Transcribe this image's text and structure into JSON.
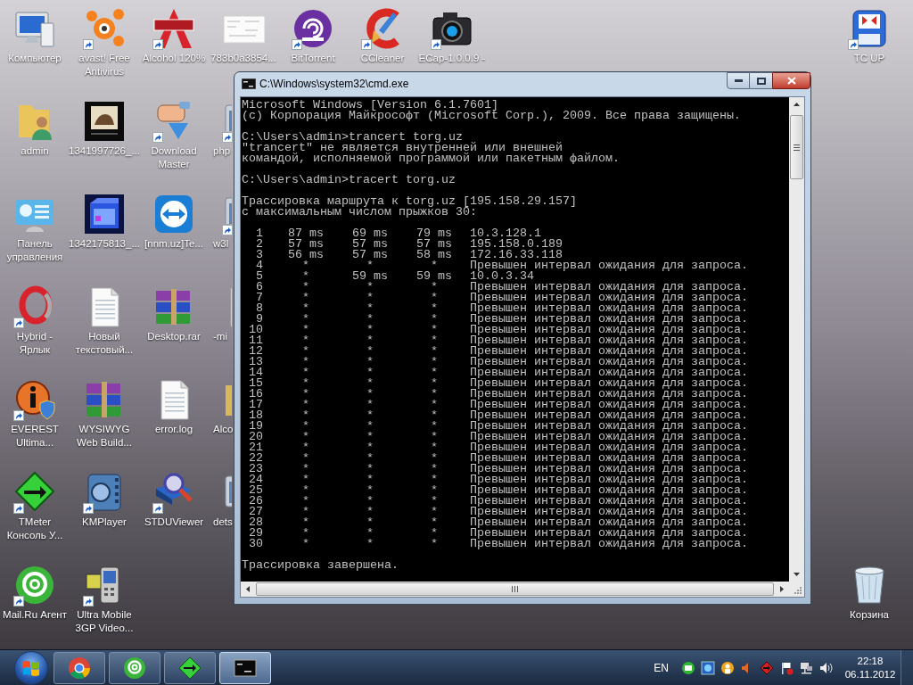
{
  "desktop": {
    "columns": [
      [
        {
          "label": "Компьютер",
          "shortcut": false,
          "covered": false
        },
        {
          "label": "admin",
          "shortcut": false,
          "covered": false
        },
        {
          "label": "Панель\nуправления",
          "shortcut": false,
          "covered": false
        },
        {
          "label": "Hybrid -\nЯрлык",
          "shortcut": true,
          "covered": false
        },
        {
          "label": "EVEREST\nUltima...",
          "shortcut": true,
          "covered": false
        },
        {
          "label": "TMeter\nКонсоль У...",
          "shortcut": true,
          "covered": false
        },
        {
          "label": "Mail.Ru Агент",
          "shortcut": true,
          "covered": false
        }
      ],
      [
        {
          "label": "avast! Free\nAntivirus",
          "shortcut": true,
          "covered": false
        },
        {
          "label": "1341997726_...",
          "shortcut": false,
          "covered": false
        },
        {
          "label": "1342175813_...",
          "shortcut": false,
          "covered": false
        },
        {
          "label": "Новый\nтекстовый...",
          "shortcut": false,
          "covered": false
        },
        {
          "label": "WYSIWYG\nWeb Build...",
          "shortcut": false,
          "covered": false
        },
        {
          "label": "KMPlayer",
          "shortcut": true,
          "covered": false
        },
        {
          "label": "Ultra Mobile\n3GP Video...",
          "shortcut": true,
          "covered": false
        }
      ],
      [
        {
          "label": "Alcohol 120%",
          "shortcut": true,
          "covered": false
        },
        {
          "label": "Download\nMaster",
          "shortcut": true,
          "covered": false
        },
        {
          "label": "[nnm.uz]Te...",
          "shortcut": false,
          "covered": false
        },
        {
          "label": "Desktop.rar",
          "shortcut": false,
          "covered": false
        },
        {
          "label": "error.log",
          "shortcut": false,
          "covered": false
        },
        {
          "label": "STDUViewer",
          "shortcut": true,
          "covered": false
        }
      ],
      [
        {
          "label": "783b0a3854...",
          "shortcut": false,
          "covered": false
        },
        {
          "label": "php",
          "shortcut": true,
          "covered": true
        },
        {
          "label": "w3l",
          "shortcut": true,
          "covered": true
        },
        {
          "label": "-mi",
          "shortcut": false,
          "covered": true
        },
        {
          "label": "Alco",
          "shortcut": false,
          "covered": true
        },
        {
          "label": "dets",
          "shortcut": false,
          "covered": true
        }
      ],
      [
        {
          "label": "BitTorrent",
          "shortcut": true,
          "covered": false
        }
      ],
      [
        {
          "label": "CCleaner",
          "shortcut": true,
          "covered": false
        }
      ],
      [
        {
          "label": "ECap-1.0.0.9 -",
          "shortcut": true,
          "covered": false
        }
      ]
    ],
    "right_column": [
      {
        "label": "TC UP",
        "shortcut": true,
        "covered": false
      },
      {
        "label": "Корзина",
        "shortcut": false,
        "covered": false
      }
    ]
  },
  "window": {
    "title": "C:\\Windows\\system32\\cmd.exe",
    "console": {
      "blocks": [
        [
          "Microsoft Windows [Version 6.1.7601]",
          "(c) Корпорация Майкрософт (Microsoft Corp.), 2009. Все права защищены."
        ],
        [
          "C:\\Users\\admin>trancert torg.uz",
          "\"trancert\" не является внутренней или внешней",
          "командой, исполняемой программой или пакетным файлом."
        ],
        [
          "C:\\Users\\admin>tracert torg.uz"
        ],
        [
          "Трассировка маршрута к torg.uz [195.158.29.157]",
          "с максимальным числом прыжков 30:"
        ]
      ],
      "hops": [
        {
          "hop": "1",
          "times": [
            "87 ms",
            "69 ms",
            "79 ms"
          ],
          "result": "10.3.128.1"
        },
        {
          "hop": "2",
          "times": [
            "57 ms",
            "57 ms",
            "57 ms"
          ],
          "result": "195.158.0.189"
        },
        {
          "hop": "3",
          "times": [
            "56 ms",
            "57 ms",
            "58 ms"
          ],
          "result": "172.16.33.118"
        },
        {
          "hop": "4",
          "times": [
            "*",
            "*",
            "*"
          ],
          "result": "Превышен интервал ожидания для запроса."
        },
        {
          "hop": "5",
          "times": [
            "*",
            "59 ms",
            "59 ms"
          ],
          "result": "10.0.3.34"
        },
        {
          "hop": "6",
          "times": [
            "*",
            "*",
            "*"
          ],
          "result": "Превышен интервал ожидания для запроса."
        },
        {
          "hop": "7",
          "times": [
            "*",
            "*",
            "*"
          ],
          "result": "Превышен интервал ожидания для запроса."
        },
        {
          "hop": "8",
          "times": [
            "*",
            "*",
            "*"
          ],
          "result": "Превышен интервал ожидания для запроса."
        },
        {
          "hop": "9",
          "times": [
            "*",
            "*",
            "*"
          ],
          "result": "Превышен интервал ожидания для запроса."
        },
        {
          "hop": "10",
          "times": [
            "*",
            "*",
            "*"
          ],
          "result": "Превышен интервал ожидания для запроса."
        },
        {
          "hop": "11",
          "times": [
            "*",
            "*",
            "*"
          ],
          "result": "Превышен интервал ожидания для запроса."
        },
        {
          "hop": "12",
          "times": [
            "*",
            "*",
            "*"
          ],
          "result": "Превышен интервал ожидания для запроса."
        },
        {
          "hop": "13",
          "times": [
            "*",
            "*",
            "*"
          ],
          "result": "Превышен интервал ожидания для запроса."
        },
        {
          "hop": "14",
          "times": [
            "*",
            "*",
            "*"
          ],
          "result": "Превышен интервал ожидания для запроса."
        },
        {
          "hop": "15",
          "times": [
            "*",
            "*",
            "*"
          ],
          "result": "Превышен интервал ожидания для запроса."
        },
        {
          "hop": "16",
          "times": [
            "*",
            "*",
            "*"
          ],
          "result": "Превышен интервал ожидания для запроса."
        },
        {
          "hop": "17",
          "times": [
            "*",
            "*",
            "*"
          ],
          "result": "Превышен интервал ожидания для запроса."
        },
        {
          "hop": "18",
          "times": [
            "*",
            "*",
            "*"
          ],
          "result": "Превышен интервал ожидания для запроса."
        },
        {
          "hop": "19",
          "times": [
            "*",
            "*",
            "*"
          ],
          "result": "Превышен интервал ожидания для запроса."
        },
        {
          "hop": "20",
          "times": [
            "*",
            "*",
            "*"
          ],
          "result": "Превышен интервал ожидания для запроса."
        },
        {
          "hop": "21",
          "times": [
            "*",
            "*",
            "*"
          ],
          "result": "Превышен интервал ожидания для запроса."
        },
        {
          "hop": "22",
          "times": [
            "*",
            "*",
            "*"
          ],
          "result": "Превышен интервал ожидания для запроса."
        },
        {
          "hop": "23",
          "times": [
            "*",
            "*",
            "*"
          ],
          "result": "Превышен интервал ожидания для запроса."
        },
        {
          "hop": "24",
          "times": [
            "*",
            "*",
            "*"
          ],
          "result": "Превышен интервал ожидания для запроса."
        },
        {
          "hop": "25",
          "times": [
            "*",
            "*",
            "*"
          ],
          "result": "Превышен интервал ожидания для запроса."
        },
        {
          "hop": "26",
          "times": [
            "*",
            "*",
            "*"
          ],
          "result": "Превышен интервал ожидания для запроса."
        },
        {
          "hop": "27",
          "times": [
            "*",
            "*",
            "*"
          ],
          "result": "Превышен интервал ожидания для запроса."
        },
        {
          "hop": "28",
          "times": [
            "*",
            "*",
            "*"
          ],
          "result": "Превышен интервал ожидания для запроса."
        },
        {
          "hop": "29",
          "times": [
            "*",
            "*",
            "*"
          ],
          "result": "Превышен интервал ожидания для запроса."
        },
        {
          "hop": "30",
          "times": [
            "*",
            "*",
            "*"
          ],
          "result": "Превышен интервал ожидания для запроса."
        }
      ],
      "footer": "Трассировка завершена."
    }
  },
  "taskbar": {
    "buttons": [
      {
        "selected": false
      },
      {
        "selected": false
      },
      {
        "selected": false
      },
      {
        "selected": true
      }
    ],
    "language": "EN",
    "time": "22:18",
    "date": "06.11.2012"
  }
}
